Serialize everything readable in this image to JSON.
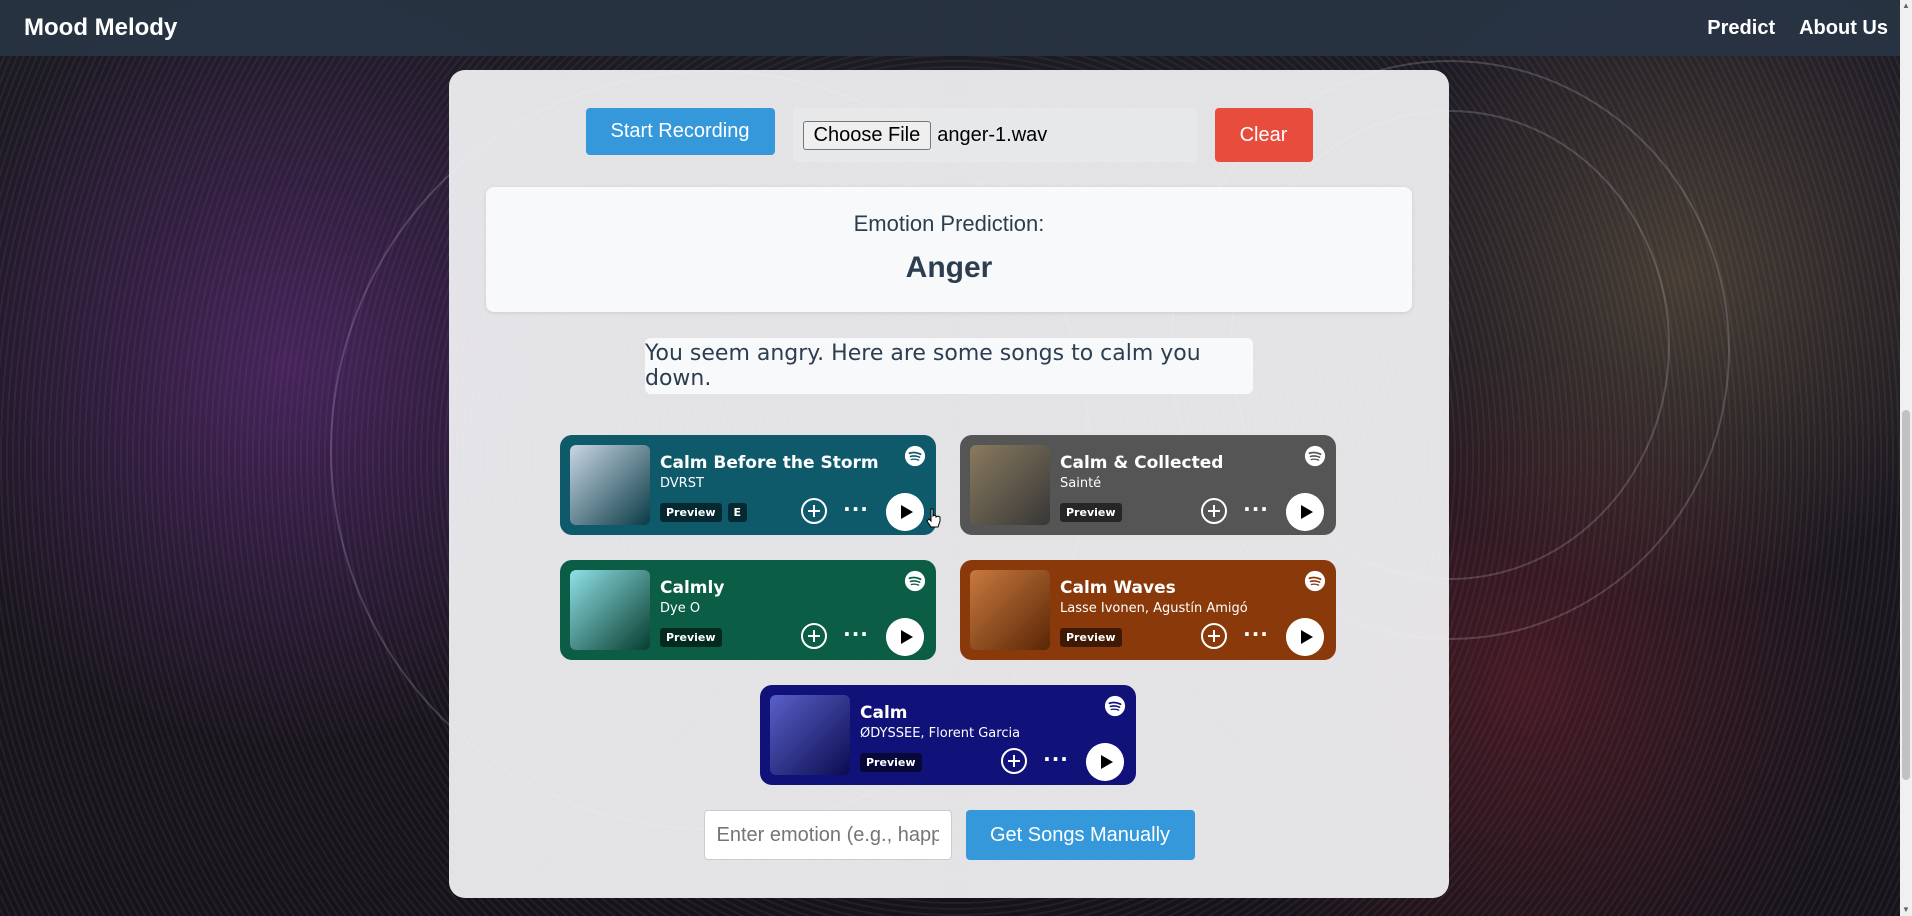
{
  "nav": {
    "brand": "Mood Melody",
    "links": [
      "Predict",
      "About Us"
    ]
  },
  "controls": {
    "record_label": "Start Recording",
    "file_button_label": "Choose File",
    "file_name": "anger-1.wav",
    "clear_label": "Clear"
  },
  "prediction": {
    "label": "Emotion Prediction:",
    "value": "Anger"
  },
  "message": "You seem angry. Here are some songs to calm you down.",
  "songs": [
    {
      "title": "Calm Before the Storm",
      "artist": "DVRST",
      "badges": [
        "Preview",
        "E"
      ],
      "color": "#0e5a6b",
      "art_color": "#c9d6e4"
    },
    {
      "title": "Calm & Collected",
      "artist": "Sainté",
      "badges": [
        "Preview"
      ],
      "color": "#555555",
      "art_color": "#8a7a5e"
    },
    {
      "title": "Calmly",
      "artist": "Dye O",
      "badges": [
        "Preview"
      ],
      "color": "#0b5d46",
      "art_color": "#8fe0e6"
    },
    {
      "title": "Calm Waves",
      "artist": "Lasse Ivonen, Agustín Amigó",
      "badges": [
        "Preview"
      ],
      "color": "#8a3a0a",
      "art_color": "#c87a3e"
    },
    {
      "title": "Calm",
      "artist": "ØDYSSEE, Florent Garcia",
      "badges": [
        "Preview"
      ],
      "color": "#10127a",
      "art_color": "#5a60c8"
    }
  ],
  "manual": {
    "placeholder": "Enter emotion (e.g., happy, sad)",
    "button_label": "Get Songs Manually"
  },
  "icons": {
    "spotify": "spotify-icon",
    "add": "add-circle-icon",
    "more": "more-icon",
    "play": "play-icon"
  }
}
